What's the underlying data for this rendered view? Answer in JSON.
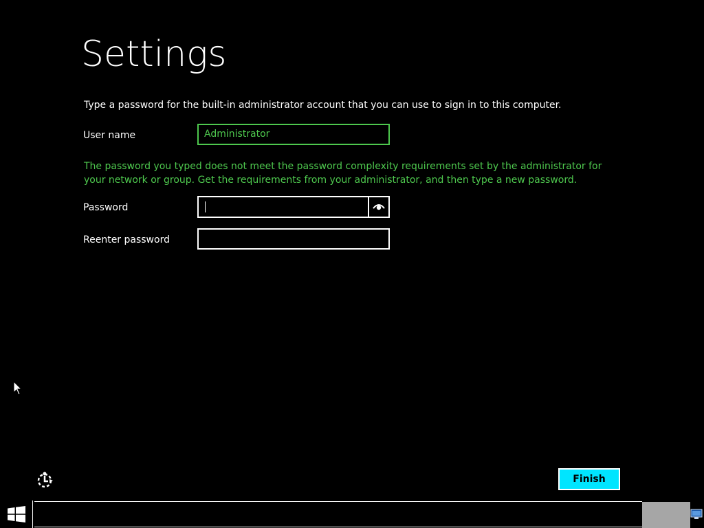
{
  "page": {
    "title": "Settings",
    "intro": "Type a password for the built-in administrator account that you can use to sign in to this computer."
  },
  "username": {
    "label": "User name",
    "value": "Administrator"
  },
  "error": {
    "message": "The password you typed does not meet the password complexity requirements set by the administrator for your network or group. Get the requirements from your administrator, and then type a new password."
  },
  "password": {
    "label": "Password",
    "value": ""
  },
  "reenter": {
    "label": "Reenter password",
    "value": ""
  },
  "actions": {
    "finish_label": "Finish"
  },
  "icons": {
    "reveal": "eye-icon",
    "ease_of_access": "ease-of-access-icon",
    "start": "windows-logo-icon",
    "network": "network-icon",
    "cursor": "mouse-pointer-icon"
  },
  "colors": {
    "background": "#000000",
    "accent_green": "#4ec84e",
    "finish_button": "#00e5ff",
    "text": "#ffffff",
    "taskbar_gray": "#a6a6a6"
  }
}
